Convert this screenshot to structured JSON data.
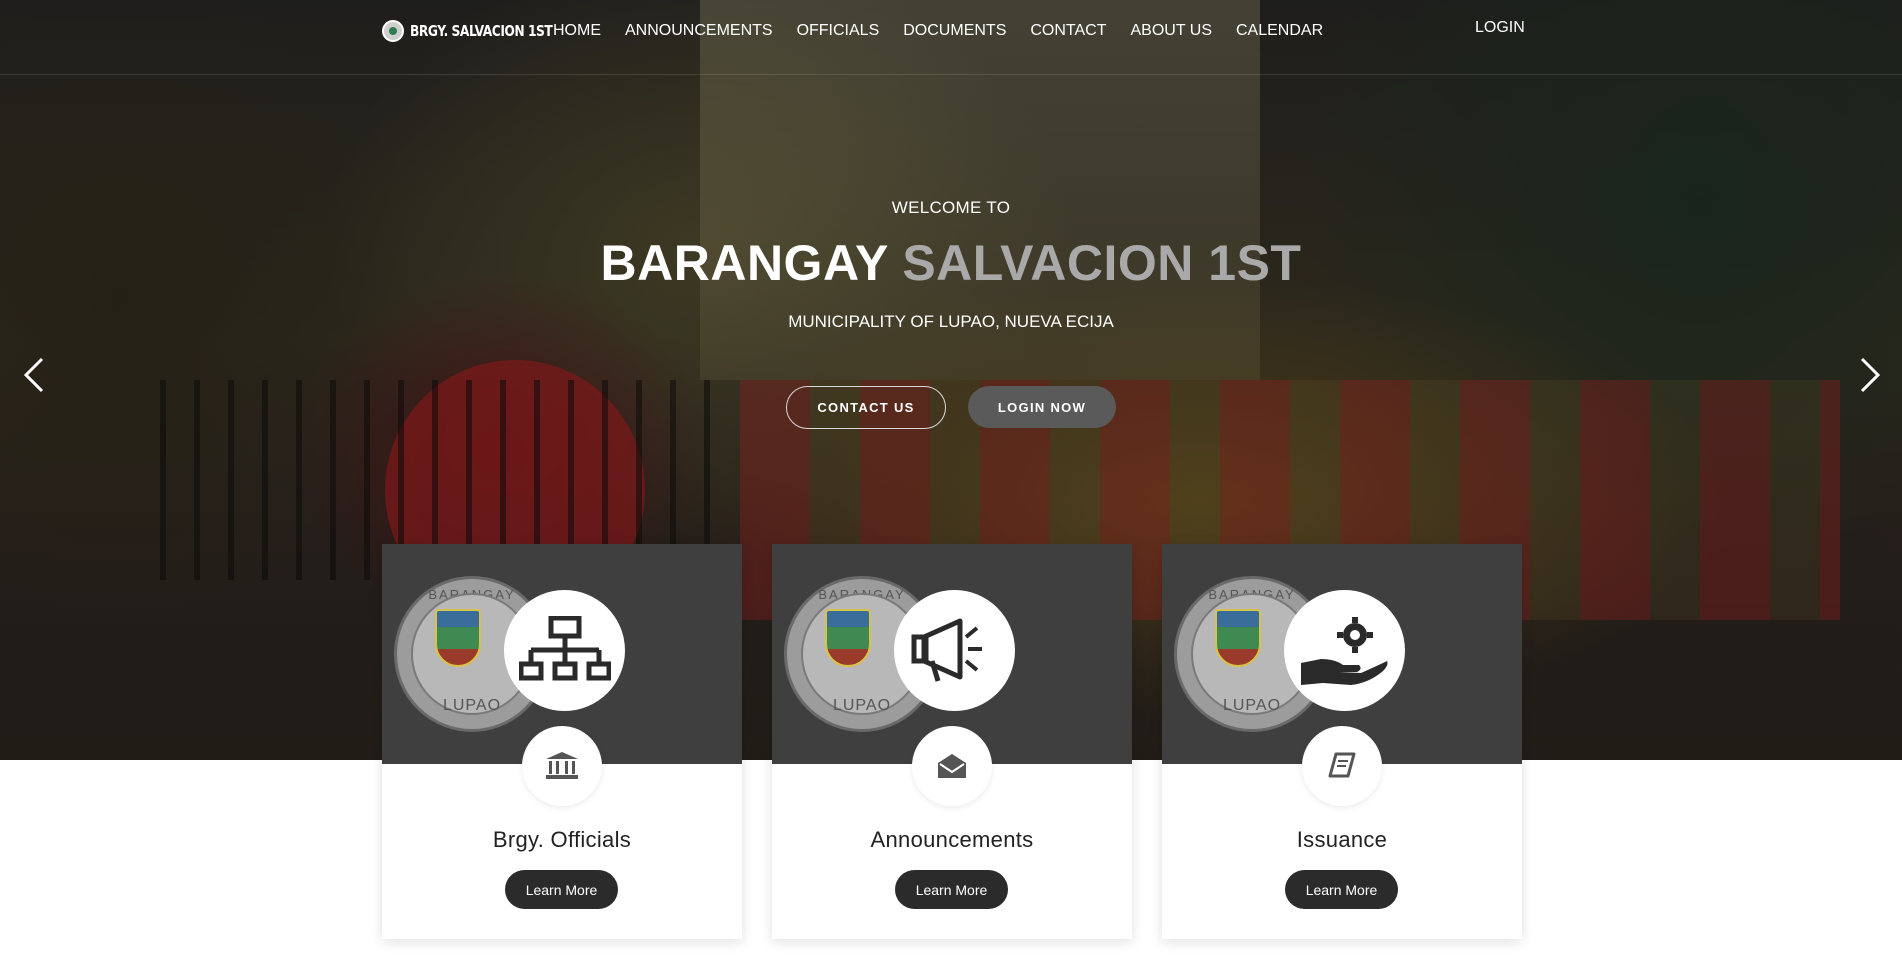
{
  "nav": {
    "brand": "BRGY. SALVACION 1ST",
    "links": [
      "HOME",
      "ANNOUNCEMENTS",
      "OFFICIALS",
      "DOCUMENTS",
      "CONTACT",
      "ABOUT US",
      "CALENDAR"
    ],
    "login": "LOGIN"
  },
  "hero": {
    "welcome": "WELCOME TO",
    "title_main": "BARANGAY",
    "title_accent": "SALVACION 1ST",
    "subtitle": "MUNICIPALITY OF LUPAO, NUEVA ECIJA",
    "contact_button": "CONTACT US",
    "login_button": "LOGIN NOW"
  },
  "cards": [
    {
      "title": "Brgy. Officials",
      "button": "Learn More",
      "big_icon": "org-chart-icon",
      "small_icon": "bank-icon"
    },
    {
      "title": "Announcements",
      "button": "Learn More",
      "big_icon": "megaphone-icon",
      "small_icon": "envelope-open-icon"
    },
    {
      "title": "Issuance",
      "button": "Learn More",
      "big_icon": "hand-gear-icon",
      "small_icon": "book-icon"
    }
  ],
  "seal": {
    "top_text": "BARANGAY SALVAC",
    "bottom_text": "LUPAO"
  },
  "colors": {
    "accent_title": "#a9a9a9",
    "card_top": "#3f3f3f",
    "button_dark": "#2b2b2b",
    "login_now_bg": "#5a5a5a"
  }
}
